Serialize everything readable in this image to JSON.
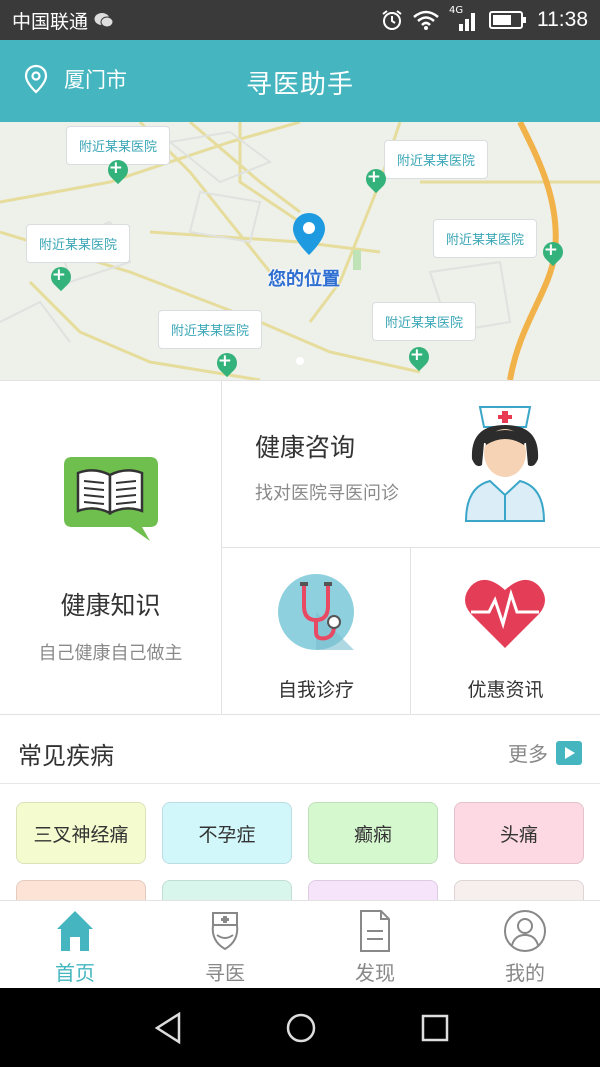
{
  "status_bar": {
    "carrier": "中国联通",
    "network": "4G",
    "time": "11:38"
  },
  "header": {
    "location": "厦门市",
    "title": "寻医助手"
  },
  "map": {
    "hospital_labels": [
      "附近某某医院",
      "附近某某医院",
      "附近某某医院",
      "附近某某医院",
      "附近某某医院",
      "附近某某医院"
    ],
    "you_are_here": "您的位置"
  },
  "features": {
    "knowledge": {
      "title": "健康知识",
      "subtitle": "自己健康自己做主"
    },
    "consult": {
      "title": "健康咨询",
      "subtitle": "找对医院寻医问诊"
    },
    "self_diagnosis": {
      "title": "自我诊疗"
    },
    "deals": {
      "title": "优惠资讯"
    }
  },
  "diseases": {
    "title": "常见疾病",
    "more": "更多",
    "items": [
      {
        "label": "三叉神经痛",
        "color": "#f4fccf"
      },
      {
        "label": "不孕症",
        "color": "#d2f7fb"
      },
      {
        "label": "癫痫",
        "color": "#d6f8cf"
      },
      {
        "label": "头痛",
        "color": "#fcd9e3"
      }
    ],
    "row2_colors": [
      "#fde3d6",
      "#d8f6ec",
      "#f6e4fb",
      "#f7eeee"
    ]
  },
  "tabs": [
    {
      "label": "首页",
      "icon": "home-icon",
      "active": true
    },
    {
      "label": "寻医",
      "icon": "doctor-icon",
      "active": false
    },
    {
      "label": "发现",
      "icon": "document-icon",
      "active": false
    },
    {
      "label": "我的",
      "icon": "user-icon",
      "active": false
    }
  ],
  "colors": {
    "accent": "#45b6bf",
    "hospital_pin": "#34b27b",
    "location_pin": "#1e9be0"
  }
}
